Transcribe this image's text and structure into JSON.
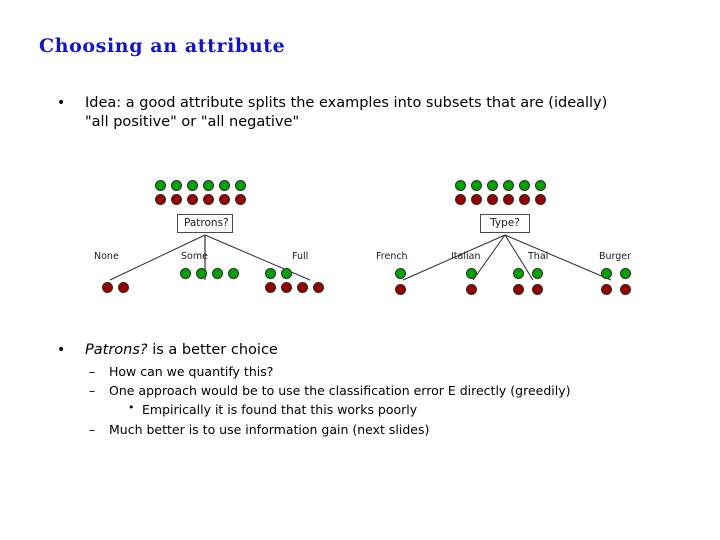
{
  "slide": {
    "title": "Choosing an attribute",
    "title_color": "#1414c8",
    "background_color": "#ffffff",
    "bullets": {
      "idea": {
        "marker": "•",
        "text": "Idea: a good attribute splits the examples into subsets that are (ideally) \"all positive\" or \"all negative\""
      },
      "conclusion": {
        "marker": "•",
        "emphasis": "Patrons?",
        "rest": " is a better choice"
      },
      "sub_items": [
        {
          "marker": "–",
          "text": "How can we quantify this?"
        },
        {
          "marker": "–",
          "text": "One approach would be to use the classification error E directly (greedily)"
        },
        {
          "marker": "•",
          "text": "Empirically it is found that this works poorly"
        },
        {
          "marker": "–",
          "text": "Much better is to use information gain (next slides)"
        }
      ]
    }
  },
  "diagram": {
    "positive_color": "#00a400",
    "negative_color": "#990000",
    "trees": [
      {
        "id": "patrons",
        "root_label": "Patrons?",
        "root_positives": 6,
        "root_negatives": 6,
        "branches": [
          {
            "label": "None",
            "positives": 0,
            "negatives": 2
          },
          {
            "label": "Some",
            "positives": 4,
            "negatives": 0
          },
          {
            "label": "Full",
            "positives": 2,
            "negatives": 4
          }
        ]
      },
      {
        "id": "type",
        "root_label": "Type?",
        "root_positives": 6,
        "root_negatives": 6,
        "branches": [
          {
            "label": "French",
            "positives": 1,
            "negatives": 1
          },
          {
            "label": "Italian",
            "positives": 1,
            "negatives": 1
          },
          {
            "label": "Thai",
            "positives": 2,
            "negatives": 2
          },
          {
            "label": "Burger",
            "positives": 2,
            "negatives": 2
          }
        ]
      }
    ]
  }
}
